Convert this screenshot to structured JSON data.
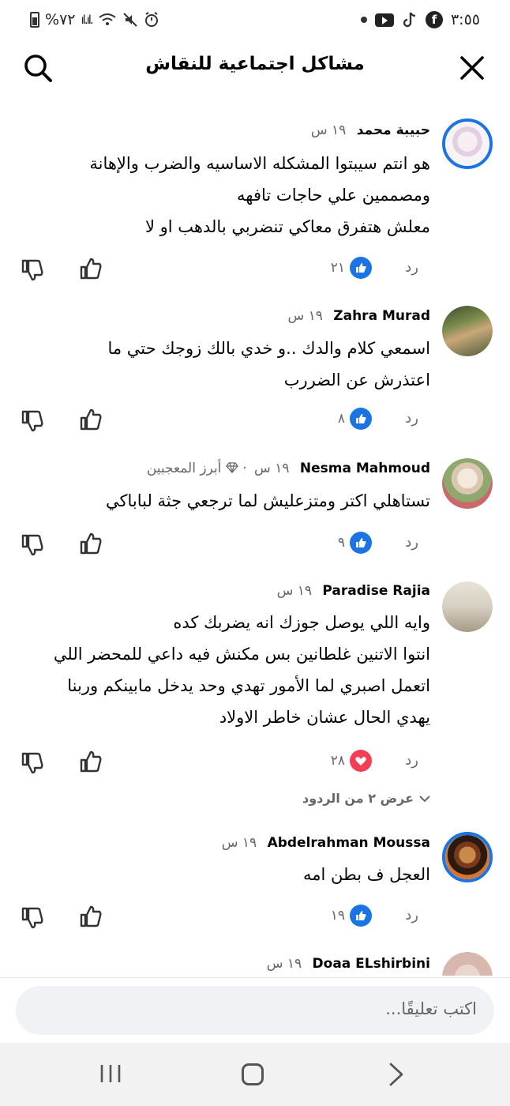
{
  "status_bar": {
    "time": "٣:٥٥",
    "battery": "%٧٢",
    "signal": "ıl.ıl."
  },
  "header": {
    "title": "مشاكل اجتماعية للنقاش"
  },
  "ui": {
    "reply_label": "رد",
    "view_replies": "عرض ٢ من الردود",
    "composer_placeholder": "اكتب تعليقًا..."
  },
  "comments": [
    {
      "name": "حبيبة محمد",
      "time": "١٩ س",
      "text_lines": [
        "هو انتم سيبتوا المشكله الاساسيه والضرب والإهانة",
        "ومصممين علي حاجات تافهه",
        "معلش هتفرق معاكي تنضربي بالدهب او لا"
      ],
      "reaction_type": "like",
      "reaction_count": "٢١"
    },
    {
      "name": "Zahra Murad",
      "time": "١٩ س",
      "text_lines": [
        "اسمعي كلام والدك ..و خدي بالك زوجك حتي ما",
        "اعتذرش عن الضررب"
      ],
      "reaction_type": "like",
      "reaction_count": "٨"
    },
    {
      "name": "Nesma Mahmoud",
      "time": "١٩ س",
      "badge": "أبرز المعجبين",
      "text_lines": [
        "تستاهلي اكتر ومتزعليش لما ترجعي جثة لباباكي"
      ],
      "reaction_type": "like",
      "reaction_count": "٩"
    },
    {
      "name": "Paradise Rajia",
      "time": "١٩ س",
      "text_lines": [
        "وايه اللي يوصل جوزك انه يضربك كده",
        "انتوا الاتنين غلطانين بس مكنش فيه داعي للمحضر اللي",
        "اتعمل اصبري لما الأمور تهدي وحد يدخل مابينكم وربنا",
        "يهدي الحال عشان خاطر الاولاد"
      ],
      "reaction_type": "love",
      "reaction_count": "٢٨"
    },
    {
      "name": "Abdelrahman Moussa",
      "time": "١٩ س",
      "text_lines": [
        "العجل ف بطن امه"
      ],
      "reaction_type": "like",
      "reaction_count": "١٩"
    },
    {
      "name": "Doaa ELshirbini",
      "time": "١٩ س",
      "text_lines": []
    }
  ],
  "colors": {
    "accent": "#1b74e4",
    "love": "#f33e58",
    "muted": "#65676b"
  }
}
